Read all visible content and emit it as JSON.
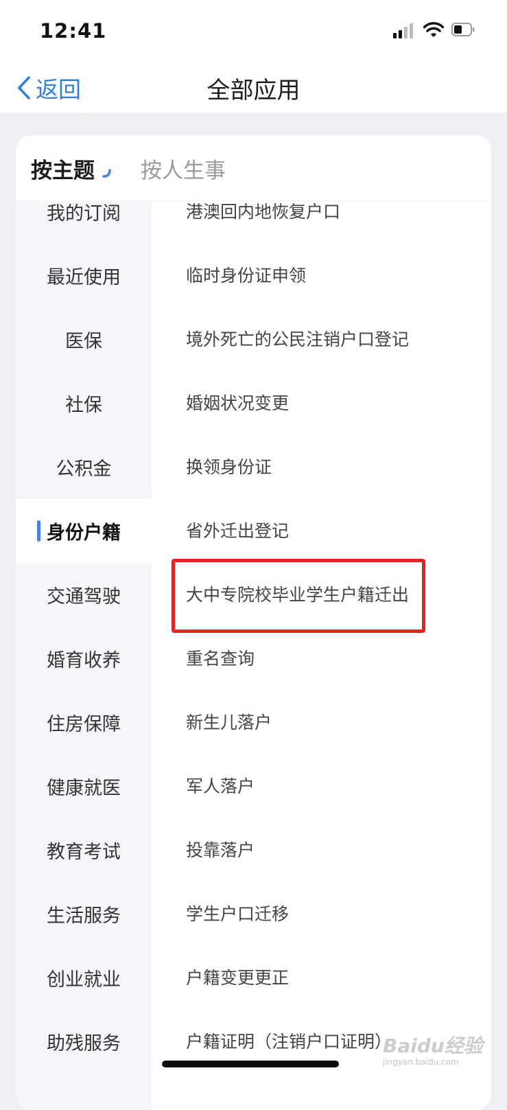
{
  "status": {
    "time": "12:41"
  },
  "nav": {
    "back_label": "返回",
    "title": "全部应用"
  },
  "tabs": {
    "topic": "按主题",
    "life": "按人生事"
  },
  "sidebar": {
    "items": [
      {
        "label": "我的订阅"
      },
      {
        "label": "最近使用"
      },
      {
        "label": "医保"
      },
      {
        "label": "社保"
      },
      {
        "label": "公积金"
      },
      {
        "label": "身份户籍",
        "active": true
      },
      {
        "label": "交通驾驶"
      },
      {
        "label": "婚育收养"
      },
      {
        "label": "住房保障"
      },
      {
        "label": "健康就医"
      },
      {
        "label": "教育考试"
      },
      {
        "label": "生活服务"
      },
      {
        "label": "创业就业"
      },
      {
        "label": "助残服务"
      }
    ]
  },
  "services": {
    "items": [
      {
        "label": "港澳回内地恢复户口"
      },
      {
        "label": "临时身份证申领"
      },
      {
        "label": "境外死亡的公民注销户口登记"
      },
      {
        "label": "婚姻状况变更"
      },
      {
        "label": "换领身份证"
      },
      {
        "label": "省外迁出登记"
      },
      {
        "label": "大中专院校毕业学生户籍迁出",
        "highlighted": true
      },
      {
        "label": "重名查询"
      },
      {
        "label": "新生儿落户"
      },
      {
        "label": "军人落户"
      },
      {
        "label": "投靠落户"
      },
      {
        "label": "学生户口迁移"
      },
      {
        "label": "户籍变更更正"
      },
      {
        "label": "户籍证明（注销户口证明）"
      }
    ]
  },
  "watermark": {
    "main": "Baidu经验",
    "sub": "jingyan.baidu.com"
  },
  "colors": {
    "accent": "#2d7fe0",
    "active_bar": "#4a7ee8",
    "highlight": "#e22524"
  }
}
